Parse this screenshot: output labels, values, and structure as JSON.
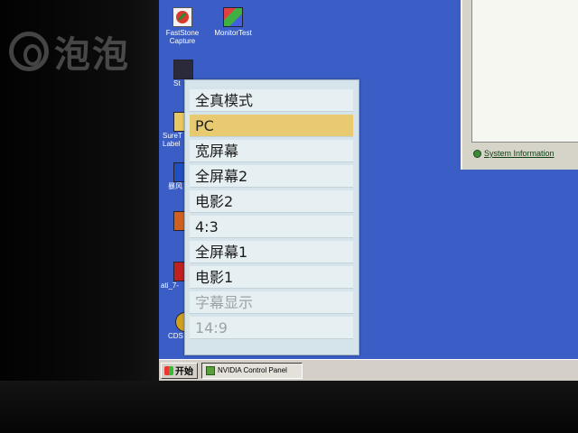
{
  "watermark": {
    "text": "泡泡"
  },
  "desktop": {
    "icons": [
      {
        "name": "faststone-capture-icon",
        "label1": "FastStone",
        "label2": "Capture",
        "color": "#d93a2b"
      },
      {
        "name": "monitortest-icon",
        "label1": "MonitorTest",
        "label2": "",
        "color": "#6a9a3a"
      },
      {
        "name": "steam-icon",
        "label1": "St",
        "label2": "",
        "color": "#2a2a3a"
      },
      {
        "name": "suretype-label-icon",
        "label1": "SureT",
        "label2": "Label",
        "color": "#c8a030"
      },
      {
        "name": "baofeng-icon",
        "label1": "暴风",
        "label2": "",
        "color": "#2050c0"
      },
      {
        "name": "app-icon",
        "label1": "",
        "label2": "",
        "color": "#d06020"
      },
      {
        "name": "ati-icon",
        "label1": "ati_7-",
        "label2": "",
        "color": "#c02020"
      },
      {
        "name": "cds-icon",
        "label1": "CDS",
        "label2": "",
        "color": "#d0a020"
      }
    ]
  },
  "osd_menu": {
    "items": [
      {
        "label": "全真模式",
        "state": "normal"
      },
      {
        "label": "PC",
        "state": "selected"
      },
      {
        "label": "宽屏幕",
        "state": "normal"
      },
      {
        "label": "全屏幕2",
        "state": "normal"
      },
      {
        "label": "电影2",
        "state": "normal"
      },
      {
        "label": "4:3",
        "state": "normal"
      },
      {
        "label": "全屏幕1",
        "state": "normal"
      },
      {
        "label": "电影1",
        "state": "normal"
      },
      {
        "label": "字幕显示",
        "state": "disabled"
      },
      {
        "label": "14:9",
        "state": "disabled"
      }
    ]
  },
  "sysinfo_window": {
    "link_label": "System Information"
  },
  "taskbar": {
    "start_label": "开始",
    "task_label": "NVIDIA Control Panel"
  }
}
